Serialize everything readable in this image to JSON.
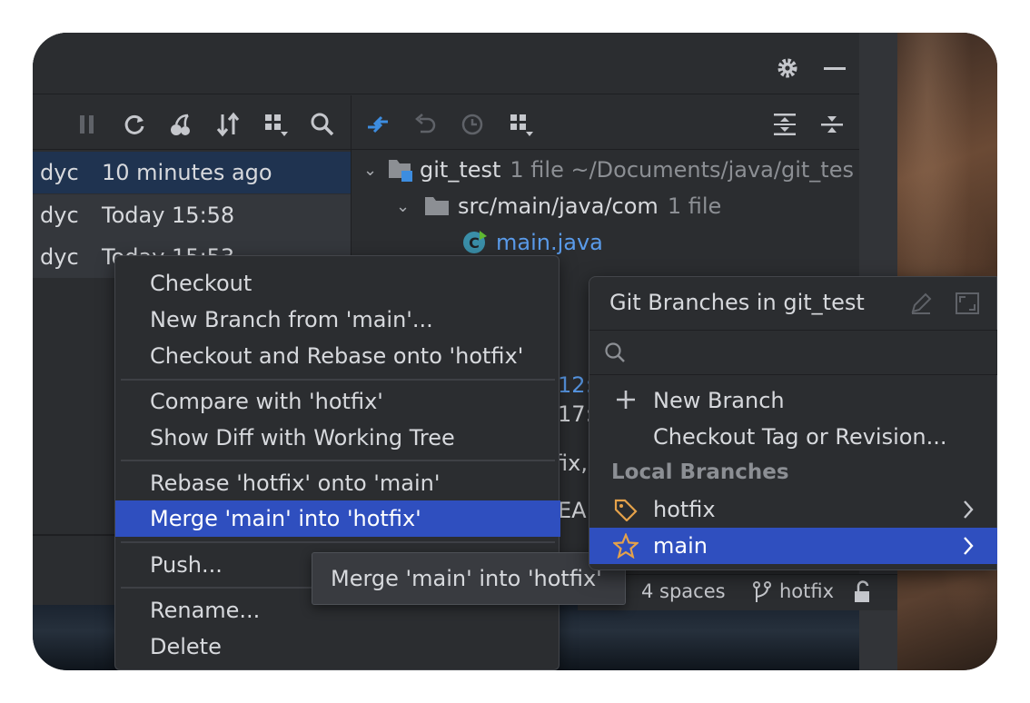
{
  "commits": [
    {
      "author": "dyc",
      "date": "10 minutes ago"
    },
    {
      "author": "dyc",
      "date": "Today 15:58"
    },
    {
      "author": "dyc",
      "date": "Today 15:53"
    }
  ],
  "file_tree": {
    "root": {
      "name": "git_test",
      "meta": "1 file  ~/Documents/java/git_tes"
    },
    "folder": {
      "name": "src/main/java/com",
      "meta": "1 file"
    },
    "file": {
      "name": "main.java"
    }
  },
  "partial_text": {
    "a": "12:",
    "b": "17:",
    "c": "fix,",
    "d": "EA"
  },
  "context_menu": {
    "items": [
      {
        "label": "Checkout"
      },
      {
        "label": "New Branch from 'main'..."
      },
      {
        "label": "Checkout and Rebase onto 'hotfix'"
      },
      {
        "label": "Compare with 'hotfix'"
      },
      {
        "label": "Show Diff with Working Tree"
      },
      {
        "label": "Rebase 'hotfix' onto 'main'"
      },
      {
        "label": "Merge 'main' into 'hotfix'"
      },
      {
        "label": "Push..."
      },
      {
        "label": "Rename..."
      },
      {
        "label": "Delete"
      }
    ]
  },
  "tooltip": "Merge 'main' into 'hotfix'",
  "branches_popup": {
    "title": "Git Branches in git_test",
    "search_placeholder": "",
    "new_branch": "New Branch",
    "checkout_tag": "Checkout Tag or Revision...",
    "local_header": "Local Branches",
    "local": [
      {
        "name": "hotfix"
      },
      {
        "name": "main"
      }
    ]
  },
  "statusbar": {
    "indent": "4 spaces",
    "branch": "hotfix"
  },
  "colors": {
    "selection": "#2f4fbf",
    "star": "#e5a24a",
    "tag": "#e5a24a"
  }
}
